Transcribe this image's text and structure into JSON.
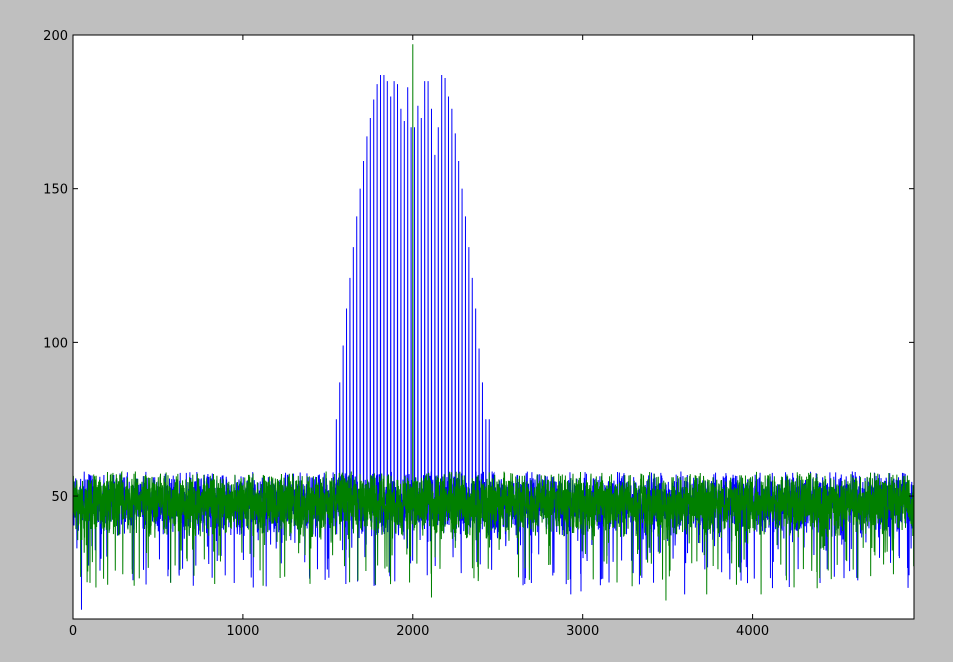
{
  "chart_data": {
    "type": "line",
    "title": "",
    "xlabel": "",
    "ylabel": "",
    "xlim": [
      0,
      4950
    ],
    "ylim": [
      10,
      200
    ],
    "xticks": [
      0,
      1000,
      2000,
      3000,
      4000
    ],
    "yticks": [
      50,
      100,
      150,
      200
    ],
    "xtick_labels": [
      "0",
      "1000",
      "2000",
      "3000",
      "4000"
    ],
    "ytick_labels": [
      "50",
      "100",
      "150",
      "200"
    ],
    "grid": false,
    "legend": "none",
    "noise": {
      "baseline": 48,
      "typical_spread": 8,
      "min_dips": 13,
      "max_spikes": 60,
      "samples": 4950
    },
    "series": [
      {
        "color": "#0000ff",
        "peaks": {
          "x": [
            1550,
            1570,
            1590,
            1610,
            1630,
            1650,
            1670,
            1690,
            1710,
            1730,
            1750,
            1770,
            1790,
            1810,
            1830,
            1850,
            1870,
            1890,
            1910,
            1930,
            1950,
            1970,
            1990,
            2010,
            2030,
            2050,
            2070,
            2090,
            2110,
            2130,
            2150,
            2170,
            2190,
            2210,
            2230,
            2250,
            2270,
            2290,
            2310,
            2330,
            2350,
            2370,
            2390,
            2410,
            2430,
            2450
          ],
          "y": [
            75,
            87,
            99,
            111,
            121,
            131,
            141,
            150,
            159,
            167,
            173,
            179,
            184,
            187,
            187,
            185,
            180,
            185,
            184,
            176,
            172,
            183,
            170,
            170,
            177,
            173,
            185,
            185,
            176,
            161,
            170,
            187,
            186,
            180,
            176,
            168,
            159,
            150,
            141,
            131,
            121,
            111,
            98,
            87,
            75,
            75
          ]
        },
        "deep_dips": {
          "x": [
            50,
            1780,
            1830,
            1990,
            2330,
            2930,
            2990,
            3600
          ],
          "y": [
            13,
            21,
            18,
            22,
            25,
            18,
            19,
            18
          ]
        }
      },
      {
        "color": "#008000",
        "spike": {
          "x": 2000,
          "y": 197
        },
        "deep_dips": {
          "x": [
            2110,
            3490,
            3730,
            4050,
            4380
          ],
          "y": [
            17,
            16,
            18,
            18,
            20
          ]
        }
      }
    ]
  }
}
